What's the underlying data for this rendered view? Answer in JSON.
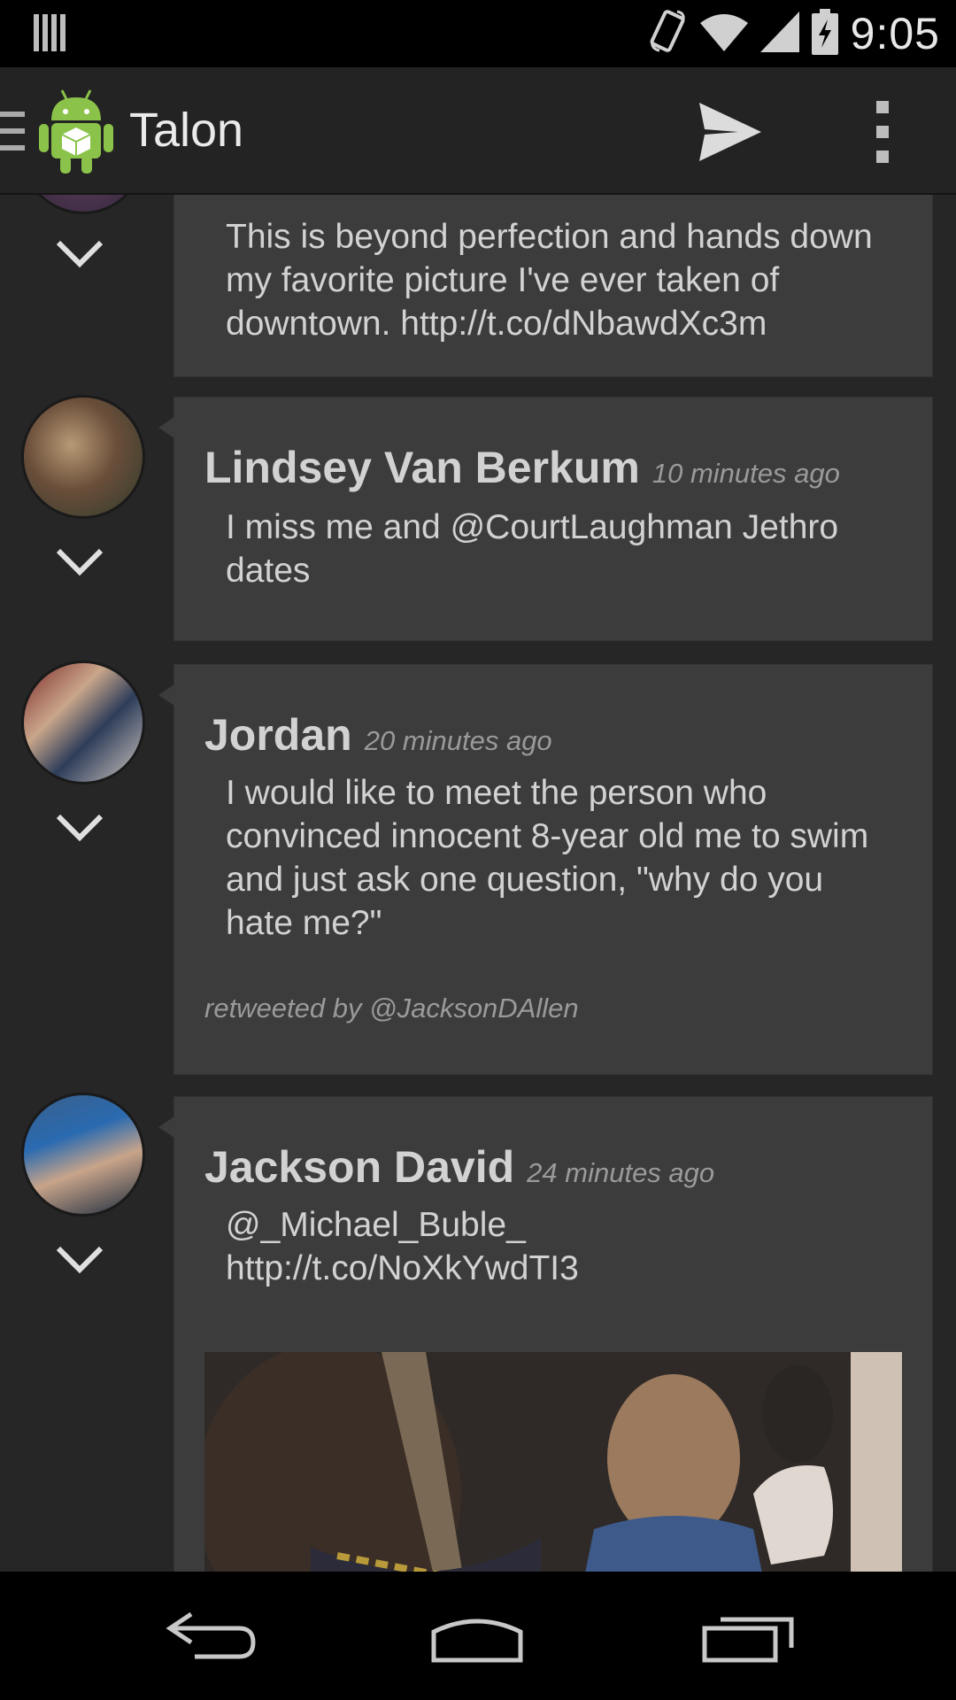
{
  "status_bar": {
    "time": "9:05",
    "icons": [
      "notification-bars-icon",
      "rotation-icon",
      "wifi-icon",
      "signal-icon",
      "battery-charging-icon"
    ]
  },
  "action_bar": {
    "title": "Talon",
    "icons": [
      "drawer-icon",
      "android-app-icon",
      "send-icon",
      "overflow-menu-icon"
    ]
  },
  "tweets": [
    {
      "name": "",
      "time": "",
      "text": "This is beyond perfection and hands down my favorite picture I've ever taken of downtown. http://t.co/dNbawdXc3m"
    },
    {
      "name": "Lindsey Van Berkum",
      "time": "10 minutes ago",
      "text": "I miss me and @CourtLaughman Jethro dates"
    },
    {
      "name": "Jordan",
      "time": "20 minutes ago",
      "text": "I would like to meet the person who convinced innocent 8-year old me to swim and just ask one question, \"why do you hate me?\"",
      "retweeted_by": "retweeted by @JacksonDAllen"
    },
    {
      "name": "Jackson David",
      "time": "24 minutes ago",
      "text": "@_Michael_Buble_ http://t.co/NoXkYwdTI3"
    }
  ],
  "nav_bar": {
    "icons": [
      "back-icon",
      "home-icon",
      "recents-icon"
    ]
  },
  "colors": {
    "background": "#262626",
    "card": "#3c3c3c",
    "action_bar": "#232323",
    "text": "#d2d2d2",
    "muted": "#9a9a9a"
  }
}
